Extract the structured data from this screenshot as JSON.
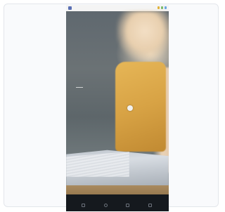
{
  "card": {
    "label": ""
  },
  "phone": {
    "status_bar": {
      "time": "",
      "indicator_colors": [
        "#e0b23a",
        "#7dbb6a",
        "#6aa6e0"
      ]
    },
    "hero": {
      "headline": "",
      "body": "",
      "cta": ""
    },
    "nav_icons": [
      "back-icon",
      "home-icon",
      "recents-icon",
      "menu-icon"
    ]
  }
}
